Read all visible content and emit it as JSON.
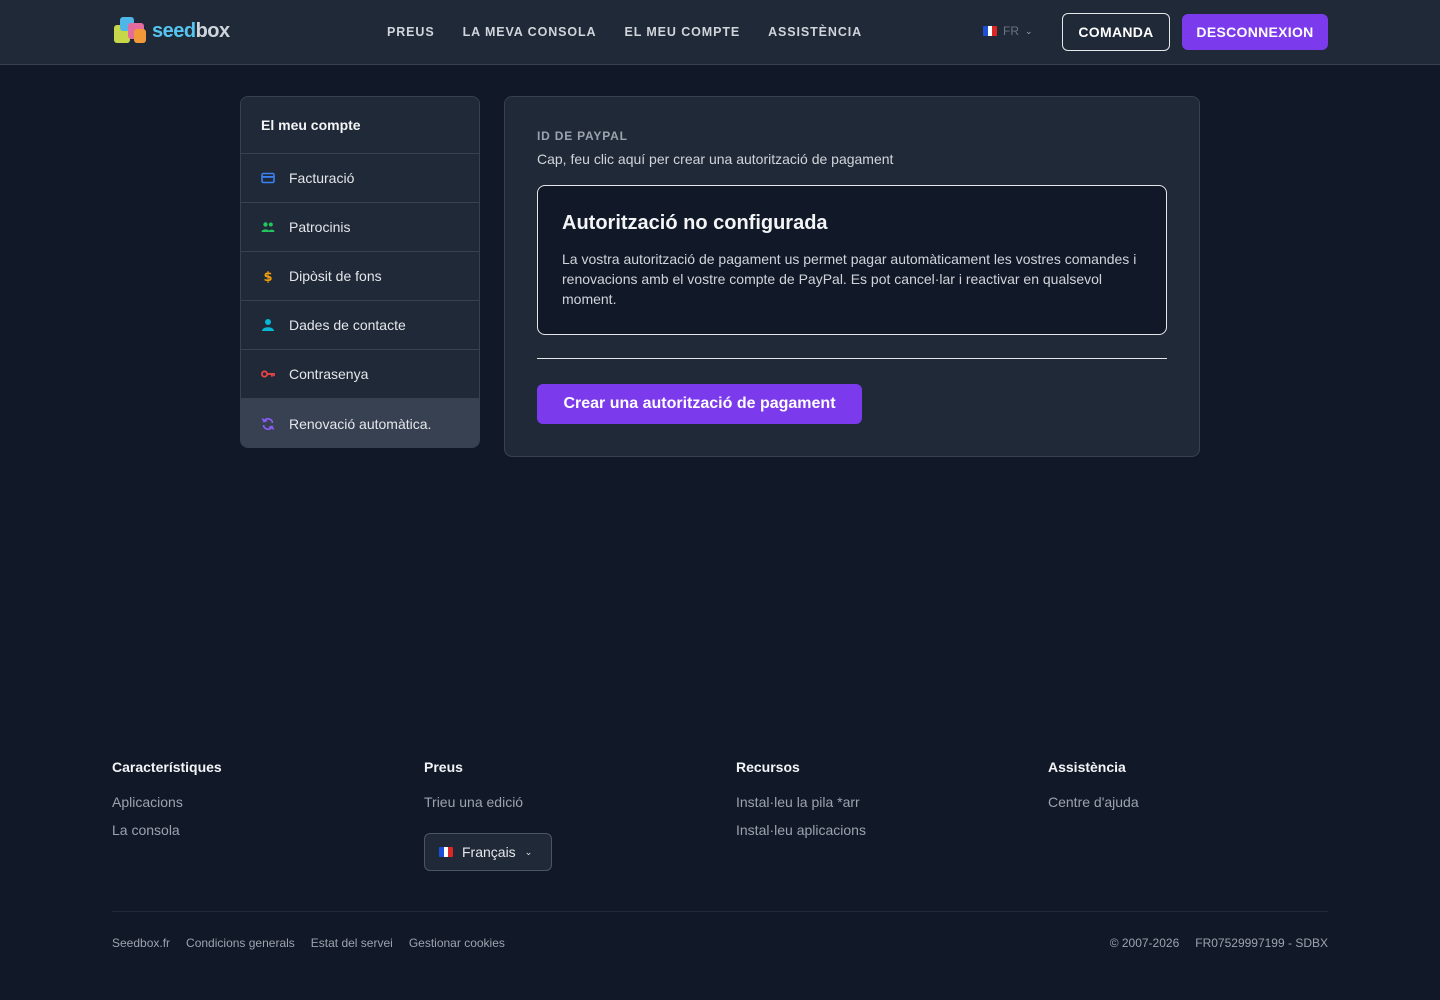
{
  "header": {
    "logo_text_a": "seed",
    "logo_text_b": "box",
    "nav": [
      "PREUS",
      "LA MEVA CONSOLA",
      "EL MEU COMPTE",
      "ASSISTÈNCIA"
    ],
    "lang": "FR",
    "order_label": "COMANDA",
    "logout_label": "DESCONNEXION"
  },
  "sidebar": {
    "title": "El meu compte",
    "items": [
      {
        "label": "Facturació",
        "icon": "credit-card-icon",
        "color": "#3b82f6"
      },
      {
        "label": "Patrocinis",
        "icon": "users-icon",
        "color": "#22c55e"
      },
      {
        "label": "Dipòsit de fons",
        "icon": "dollar-icon",
        "color": "#f59e0b"
      },
      {
        "label": "Dades de contacte",
        "icon": "user-icon",
        "color": "#06b6d4"
      },
      {
        "label": "Contrasenya",
        "icon": "key-icon",
        "color": "#ef4444"
      },
      {
        "label": "Renovació automàtica.",
        "icon": "refresh-icon",
        "color": "#8b5cf6"
      }
    ]
  },
  "main": {
    "field_label": "ID DE PAYPAL",
    "field_desc": "Cap, feu clic aquí per crear una autorització de pagament",
    "notice_title": "Autorització no configurada",
    "notice_text": "La vostra autorització de pagament us permet pagar automàticament les vostres comandes i renovacions amb el vostre compte de PayPal. Es pot cancel·lar i reactivar en qualsevol moment.",
    "create_label": "Crear una autorització de pagament"
  },
  "footer": {
    "cols": [
      {
        "title": "Característiques",
        "links": [
          "Aplicacions",
          "La consola"
        ]
      },
      {
        "title": "Preus",
        "links": [
          "Trieu una edició"
        ]
      },
      {
        "title": "Recursos",
        "links": [
          "Instal·leu la pila *arr",
          "Instal·leu aplicacions"
        ]
      },
      {
        "title": "Assistència",
        "links": [
          "Centre d'ajuda"
        ]
      }
    ],
    "language_select": "Français",
    "bottom_links": [
      "Seedbox.fr",
      "Condicions generals",
      "Estat del servei",
      "Gestionar cookies"
    ],
    "copyright": "© 2007-2026",
    "company_id": "FR07529997199 - SDBX"
  },
  "colors": {
    "accent": "#7c3aed",
    "background": "#111827",
    "panel": "#1f2937"
  }
}
